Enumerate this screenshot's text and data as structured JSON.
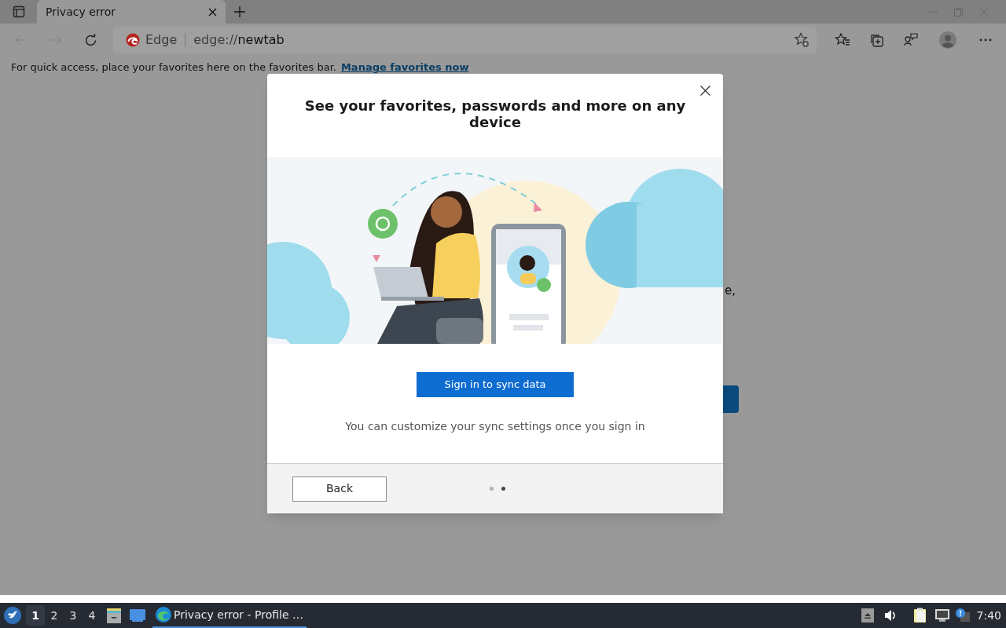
{
  "browser": {
    "tab": {
      "title": "Privacy error"
    },
    "address": {
      "site_label": "Edge",
      "url_scheme": "edge://",
      "url_path": "newtab"
    }
  },
  "favorites_bar": {
    "message": "For quick access, place your favorites here on the favorites bar.",
    "link": "Manage favorites now"
  },
  "background_page": {
    "text_fragment": "e,"
  },
  "dialog": {
    "title": "See your favorites, passwords and more on any device",
    "primary_button": "Sign in to sync data",
    "note": "You can customize your sync settings once you sign in",
    "back_button": "Back",
    "steps": [
      {
        "selected": false
      },
      {
        "selected": true
      }
    ]
  },
  "taskbar": {
    "workspaces": [
      {
        "label": "1",
        "selected": true
      },
      {
        "label": "2",
        "selected": false
      },
      {
        "label": "3",
        "selected": false
      },
      {
        "label": "4",
        "selected": false
      }
    ],
    "task": {
      "title": "Privacy error - Profile …"
    },
    "clock": "7:40"
  }
}
